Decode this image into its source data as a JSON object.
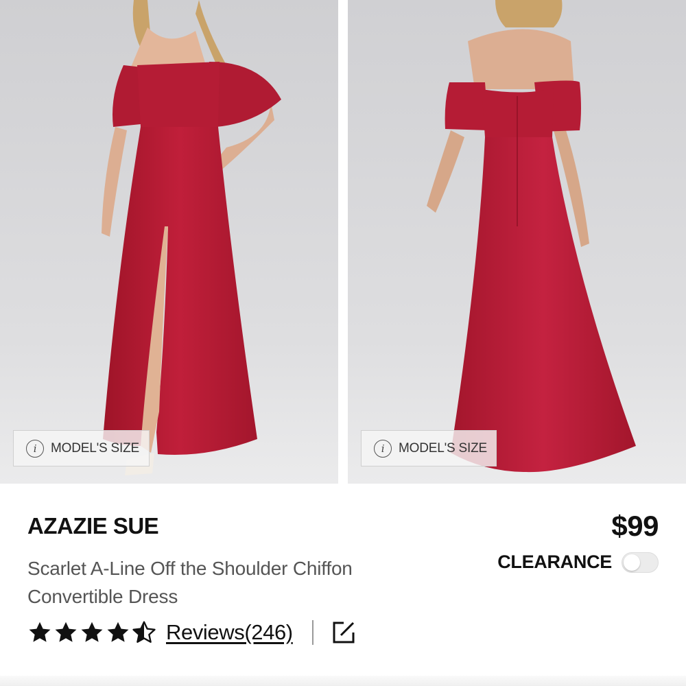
{
  "gallery": {
    "images": [
      {
        "alt": "front-view",
        "model_size_label": "MODEL'S SIZE"
      },
      {
        "alt": "back-view",
        "model_size_label": "MODEL'S SIZE"
      }
    ]
  },
  "product": {
    "brand": "AZAZIE SUE",
    "name": "Scarlet A-Line Off the Shoulder Chiffon Convertible Dress",
    "price": "$99",
    "clearance_label": "CLEARANCE",
    "clearance_on": false
  },
  "rating": {
    "value": 4.5,
    "max": 5,
    "reviews_label": "Reviews(246)"
  },
  "icons": {
    "info": "info-icon",
    "share": "external-link-icon",
    "star": "star-icon"
  },
  "colors": {
    "dress": "#b71c35",
    "backdrop": "#d9d9dc",
    "text": "#111111",
    "subtext": "#555555"
  }
}
